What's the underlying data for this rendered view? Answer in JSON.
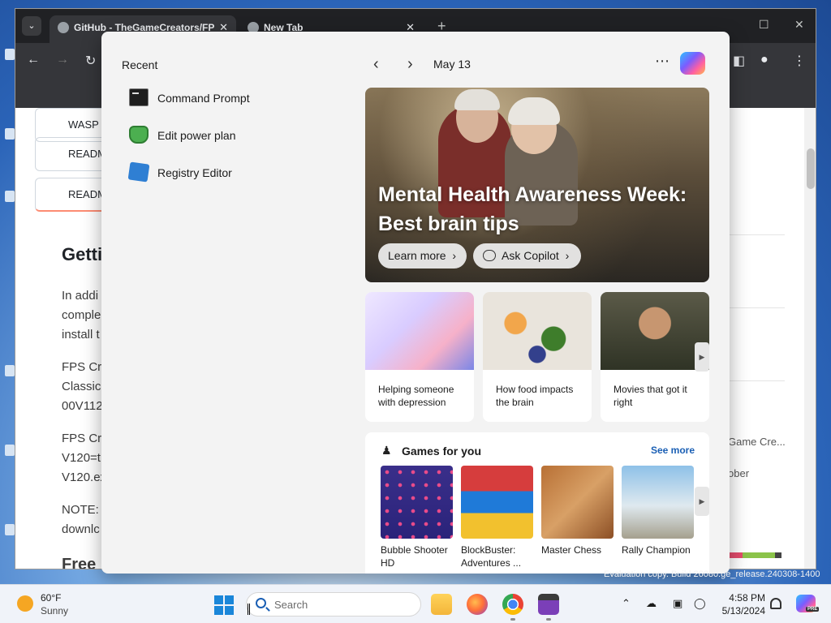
{
  "browser": {
    "tabs": [
      {
        "title": "GitHub - TheGameCreators/FP",
        "active": true
      },
      {
        "title": "New Tab",
        "active": false
      }
    ],
    "page": {
      "cards": [
        "WASP",
        "READM"
      ],
      "readme_tab": "READM",
      "heading": "Getti",
      "lines": [
        "In addi",
        "comple",
        "install t",
        "FPS Cre",
        "Classic-",
        "00V112",
        "FPS Cre",
        "V120=t",
        "V120.ex",
        "NOTE: I",
        "downlc",
        "Free"
      ],
      "right_side": [
        "Game Cre...",
        "ober"
      ]
    }
  },
  "widgets": {
    "recent": {
      "title": "Recent",
      "items": [
        {
          "label": "Command Prompt",
          "icon": "command-prompt-icon"
        },
        {
          "label": "Edit power plan",
          "icon": "power-plan-icon"
        },
        {
          "label": "Registry Editor",
          "icon": "registry-editor-icon"
        }
      ]
    },
    "header": {
      "date": "May 13",
      "prev_icon": "chevron-left-icon",
      "next_icon": "chevron-right-icon",
      "more": "⋯"
    },
    "hero": {
      "title": "Mental Health Awareness Week: Best brain tips",
      "learn_more": "Learn more",
      "ask_copilot": "Ask Copilot"
    },
    "cards": [
      {
        "caption": "Helping someone with depression"
      },
      {
        "caption": "How food impacts the brain"
      },
      {
        "caption": "Movies that got it right"
      }
    ],
    "games": {
      "title": "Games for you",
      "see_more": "See more",
      "items": [
        {
          "name": "Bubble Shooter HD"
        },
        {
          "name": "BlockBuster: Adventures ..."
        },
        {
          "name": "Master Chess"
        },
        {
          "name": "Rally Champion"
        }
      ]
    }
  },
  "taskbar": {
    "weather": {
      "temp": "60°F",
      "condition": "Sunny"
    },
    "search_placeholder": "Search",
    "clock": {
      "time": "4:58 PM",
      "date": "5/13/2024"
    },
    "watermark": "Evaluation copy. Build 26080.ge_release.240308-1400",
    "pre_badge": "PRE"
  },
  "colors": {
    "accent": "#1a5fb4",
    "tabstrip": "#202124",
    "panel": "#f3f3f3"
  }
}
